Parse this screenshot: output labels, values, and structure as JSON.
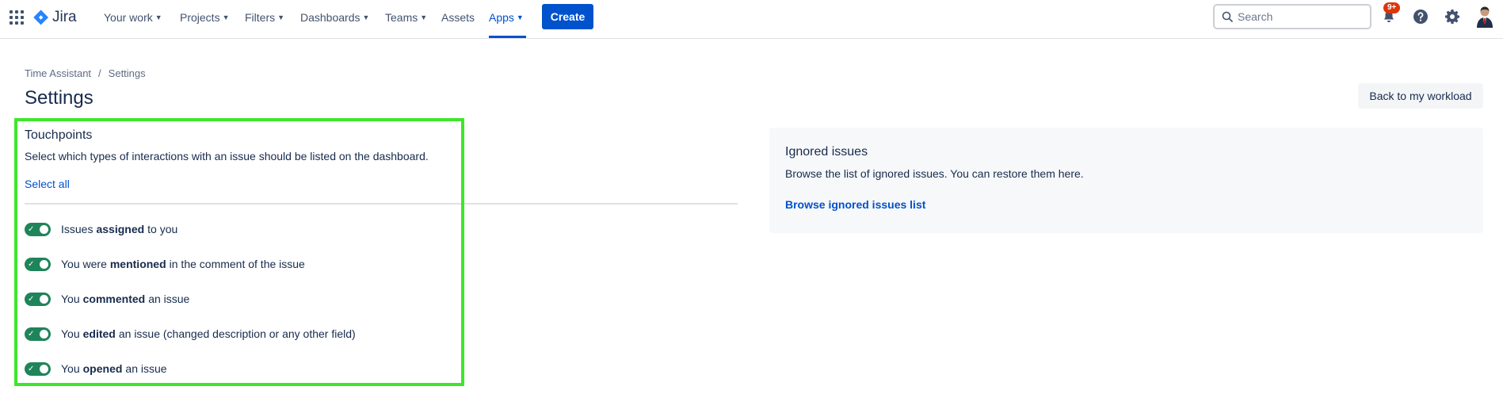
{
  "nav": {
    "logo_text": "Jira",
    "items": [
      {
        "label": "Your work"
      },
      {
        "label": "Projects"
      },
      {
        "label": "Filters"
      },
      {
        "label": "Dashboards"
      },
      {
        "label": "Teams"
      },
      {
        "label": "Assets"
      },
      {
        "label": "Apps"
      }
    ],
    "create_label": "Create",
    "search_placeholder": "Search",
    "notifications_badge": "9+",
    "accent_color": "#0052cc"
  },
  "breadcrumb": {
    "root": "Time Assistant",
    "separator": "/",
    "current": "Settings"
  },
  "page": {
    "title": "Settings",
    "back_button": "Back to my workload"
  },
  "touchpoints": {
    "title": "Touchpoints",
    "description": "Select which types of interactions with an issue should be listed on the dashboard.",
    "select_all": "Select all",
    "items": [
      {
        "before": "Issues",
        "bold": "assigned",
        "after": "to you",
        "enabled": true
      },
      {
        "before": "You were",
        "bold": "mentioned",
        "after": "in the comment of the issue",
        "enabled": true
      },
      {
        "before": "You",
        "bold": "commented",
        "after": "an issue",
        "enabled": true
      },
      {
        "before": "You",
        "bold": "edited",
        "after": "an issue (changed description or any other field)",
        "enabled": true
      },
      {
        "before": "You",
        "bold": "opened",
        "after": "an issue",
        "enabled": true
      }
    ],
    "toggle_color": "#1f845a"
  },
  "ignored": {
    "title": "Ignored issues",
    "description": "Browse the list of ignored issues. You can restore them here.",
    "link": "Browse ignored issues list"
  }
}
